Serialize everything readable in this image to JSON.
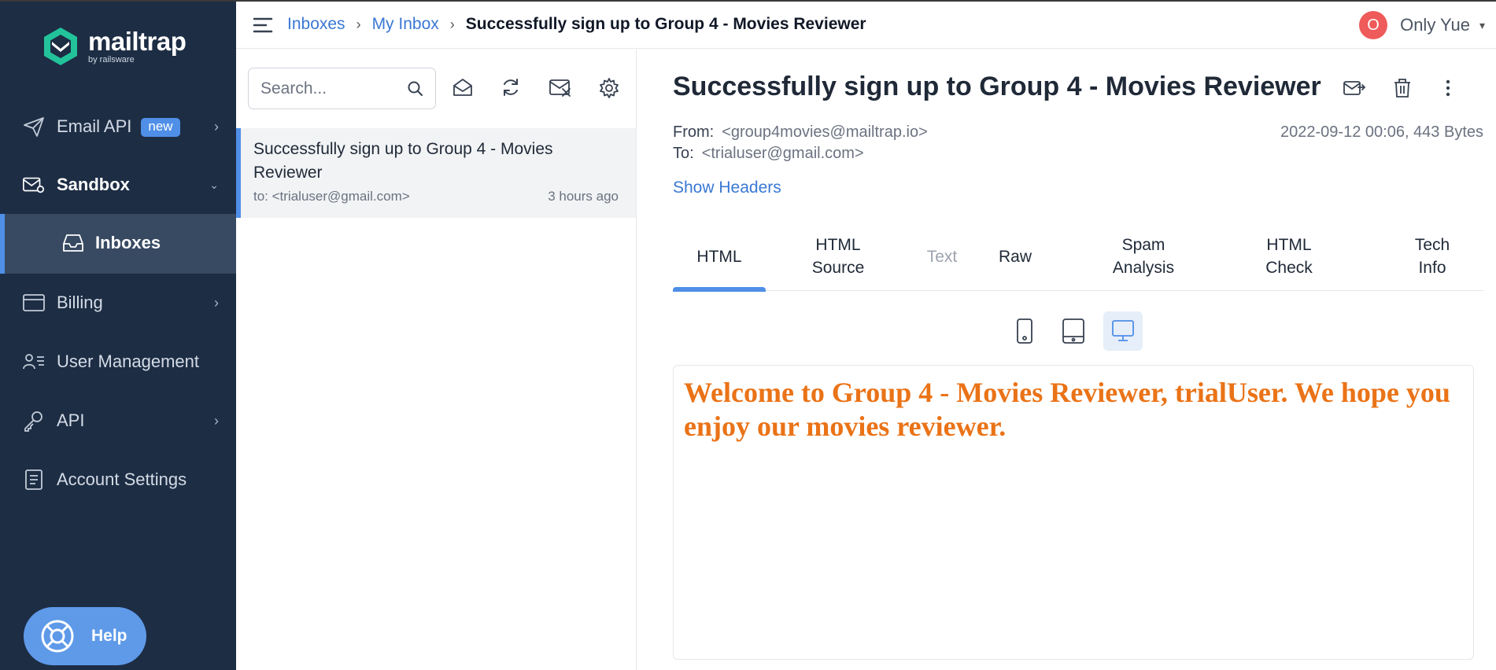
{
  "app": {
    "logo_word": "mailtrap",
    "logo_sub": "by railsware",
    "accent_color": "#4f8fe8",
    "sidebar_color": "#1d2d44"
  },
  "sidebar": {
    "items": [
      {
        "label": "Email API",
        "badge": "new",
        "icon": "paper-plane-icon"
      },
      {
        "label": "Sandbox",
        "icon": "envelope-settings-icon"
      },
      {
        "label": "Inboxes",
        "icon": "inbox-tray-icon"
      },
      {
        "label": "Billing",
        "icon": "credit-card-icon"
      },
      {
        "label": "User Management",
        "icon": "user-list-icon"
      },
      {
        "label": "API",
        "icon": "key-icon"
      },
      {
        "label": "Account Settings",
        "icon": "document-list-icon"
      }
    ],
    "help_label": "Help"
  },
  "topbar": {
    "breadcrumb": [
      "Inboxes",
      "My Inbox",
      "Successfully sign up to Group 4 - Movies Reviewer"
    ],
    "user_initial": "O",
    "user_name": "Only Yue"
  },
  "list": {
    "search_placeholder": "Search...",
    "messages": [
      {
        "subject": "Successfully sign up to Group 4 - Movies Reviewer",
        "to": "to: <trialuser@gmail.com>",
        "time": "3 hours ago"
      }
    ]
  },
  "message": {
    "subject": "Successfully sign up to Group 4 - Movies Reviewer",
    "from_label": "From:",
    "from_value": "<group4movies@mailtrap.io>",
    "to_label": "To:",
    "to_value": "<trialuser@gmail.com>",
    "meta": "2022-09-12 00:06, 443 Bytes",
    "show_headers": "Show Headers",
    "tabs": [
      {
        "label": "HTML"
      },
      {
        "label": "HTML\nSource"
      },
      {
        "label": "Text"
      },
      {
        "label": "Raw"
      },
      {
        "label": "Spam\nAnalysis"
      },
      {
        "label": "HTML\nCheck"
      },
      {
        "label": "Tech\nInfo"
      }
    ],
    "active_tab": "HTML",
    "body_text": "Welcome to Group 4 - Movies Reviewer, trialUser. We hope you enjoy our movies reviewer.",
    "body_color": "#ea7317"
  }
}
